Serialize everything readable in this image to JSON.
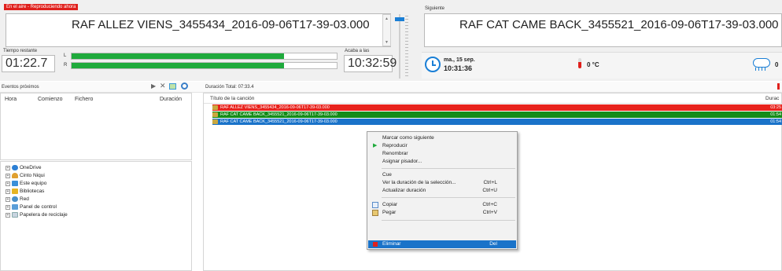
{
  "onair": {
    "badge": "En el aire - Reproduciendo ahora",
    "title": "RAF ALLEZ VIENS_3455434_2016-09-06T17-39-03.000",
    "remaining_label": "Tiempo restante",
    "remaining_time": "01:22.7",
    "channel_l": "L",
    "channel_r": "R",
    "level_l": 0.8,
    "level_r": 0.8,
    "ends_label": "Acaba a las",
    "ends_time": "10:32:59"
  },
  "next": {
    "label": "Siguiente",
    "title": "RAF CAT CAME BACK_3455521_2016-09-06T17-39-03.000"
  },
  "info": {
    "date": "ma., 15 sep.",
    "time": "10:31:36",
    "temperature": "0 °C",
    "weather_value": "0"
  },
  "events": {
    "title": "Eventos próximos",
    "columns": [
      "Hora",
      "Comienzo",
      "Fichero",
      "Duración"
    ]
  },
  "playlist": {
    "total_label": "Duración Total: 07:33.4",
    "column_title": "Título de la canción",
    "column_duration": "Durac",
    "rows": [
      {
        "title": "RAF ALLEZ VIENS_3455434_2016-09-06T17-39-03.000",
        "duration": "03:25",
        "color": "#e8231d"
      },
      {
        "title": "RAF CAT CAME BACK_3455521_2016-09-06T17-39-03.000",
        "duration": "01:54",
        "color": "#138c18"
      },
      {
        "title": "RAF CAT CAME BACK_3455521_2016-09-06T17-39-03.000",
        "duration": "01:54",
        "color": "#1a73c9"
      }
    ]
  },
  "tree": [
    {
      "label": "OneDrive",
      "icon": "cloud-icon"
    },
    {
      "label": "Cinto Niqui",
      "icon": "user-icon"
    },
    {
      "label": "Este equipo",
      "icon": "computer-icon"
    },
    {
      "label": "Bibliotecas",
      "icon": "library-icon"
    },
    {
      "label": "Red",
      "icon": "network-icon"
    },
    {
      "label": "Panel de control",
      "icon": "control-panel-icon"
    },
    {
      "label": "Papelera de reciclaje",
      "icon": "recycle-bin-icon"
    }
  ],
  "context_menu": {
    "mark_next": "Marcar como siguiente",
    "play": "Reproducir",
    "rename": "Renombrar",
    "assign_jingle": "Asignar pisador...",
    "cue": "Cue",
    "view_duration": "Ver la duración de la selección...",
    "view_duration_sc": "Ctrl+L",
    "update_duration": "Actualizar duración",
    "update_duration_sc": "Ctrl+U",
    "copy": "Copiar",
    "copy_sc": "Ctrl+C",
    "paste": "Pegar",
    "paste_sc": "Ctrl+V",
    "delete": "Eliminar",
    "delete_sc": "Del"
  },
  "colors": {
    "onair_red": "#e0201c",
    "meter_green": "#1faa3c",
    "accent_blue": "#1a7fd6",
    "highlight": "#1a73c9"
  }
}
